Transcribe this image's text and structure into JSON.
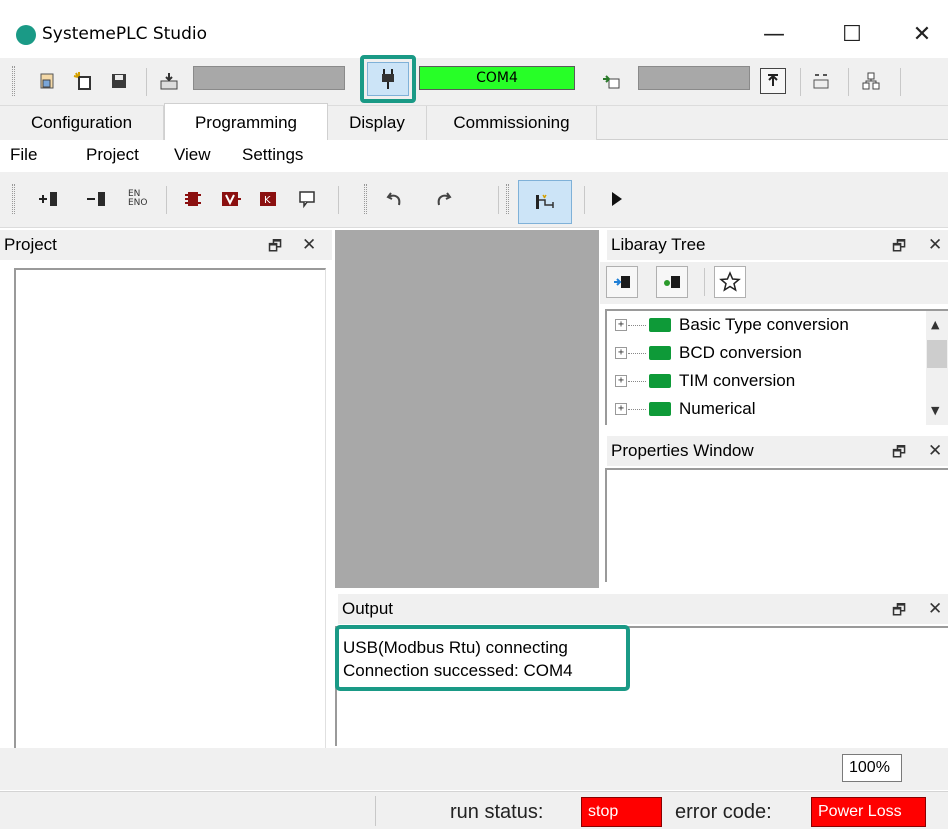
{
  "window": {
    "title": "SystemePLC Studio",
    "minimize_glyph": "—",
    "maximize_glyph": "☐",
    "close_glyph": "✕"
  },
  "main_toolbar": {
    "com_status": "COM4",
    "com_status_color": "#27ff27",
    "icons": [
      "new-file-icon",
      "new-project-icon",
      "save-icon",
      "download-icon",
      "connect-plug-icon",
      "switch-icon",
      "upload-icon",
      "monitor-icon",
      "network-icon"
    ]
  },
  "tabs": [
    {
      "label": "Configuration"
    },
    {
      "label": "Programming"
    },
    {
      "label": "Display"
    },
    {
      "label": "Commissioning"
    }
  ],
  "active_tab": "Programming",
  "menu": {
    "file": "File",
    "project": "Project",
    "view": "View",
    "settings": "Settings"
  },
  "prog_toolbar": {
    "icons": [
      "insert-rung-icon",
      "delete-rung-icon",
      "en-eno-icon",
      "function-block-icon",
      "variable-icon",
      "constant-icon",
      "comment-icon",
      "undo-icon",
      "redo-icon",
      "ladder-mode-icon",
      "run-icon"
    ],
    "en_eno_label": "EN ENO"
  },
  "project_panel": {
    "title": "Project"
  },
  "library_tree": {
    "title": "Libaray Tree",
    "items": [
      {
        "label": "Basic Type conversion"
      },
      {
        "label": "BCD conversion"
      },
      {
        "label": "TIM conversion"
      },
      {
        "label": "Numerical"
      }
    ]
  },
  "properties_window": {
    "title": "Properties Window"
  },
  "output": {
    "title": "Output",
    "lines": [
      "USB(Modbus Rtu) connecting",
      "Connection successed: COM4"
    ]
  },
  "zoom": {
    "value": "100%"
  },
  "status_bar": {
    "run_status_label": "run status:",
    "run_status_value": "stop",
    "error_code_label": "error code:",
    "error_code_value": "Power Loss",
    "alert_color": "#ff0000"
  },
  "highlight_color": "#1a9a86"
}
